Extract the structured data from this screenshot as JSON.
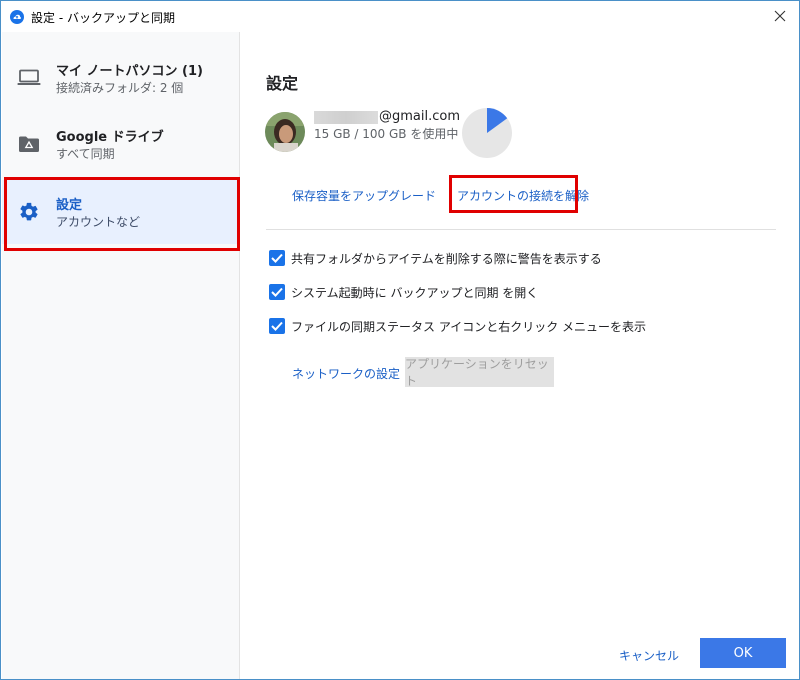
{
  "window": {
    "title": "設定 - バックアップと同期"
  },
  "sidebar": {
    "items": [
      {
        "title": "マイ ノートパソコン (1)",
        "subtitle": "接続済みフォルダ: 2 個",
        "icon": "laptop-icon"
      },
      {
        "title": "Google ドライブ",
        "subtitle": "すべて同期",
        "icon": "drive-folder-icon"
      },
      {
        "title": "設定",
        "subtitle": "アカウントなど",
        "icon": "gear-icon",
        "active": true
      }
    ]
  },
  "settings": {
    "title": "設定",
    "account": {
      "email_visible": "@gmail.com",
      "usage": "15 GB / 100 GB を使用中",
      "usage_fraction": 0.15
    },
    "links": {
      "upgrade": "保存容量をアップグレード",
      "disconnect": "アカウントの接続を解除"
    },
    "options": [
      {
        "label": "共有フォルダからアイテムを削除する際に警告を表示する",
        "checked": true
      },
      {
        "label": "システム起動時に バックアップと同期 を開く",
        "checked": true
      },
      {
        "label": "ファイルの同期ステータス アイコンと右クリック メニューを表示",
        "checked": true
      }
    ],
    "network_link": "ネットワークの設定",
    "reset_button": "アプリケーションをリセット"
  },
  "footer": {
    "cancel": "キャンセル",
    "ok": "OK"
  },
  "colors": {
    "accent": "#1a73e8",
    "link": "#1a5fc6",
    "highlight": "#e00000",
    "ok_button": "#3b78e7"
  }
}
